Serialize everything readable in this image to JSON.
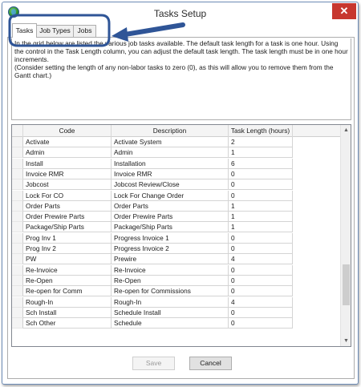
{
  "window": {
    "title": "Tasks Setup",
    "close_glyph": "✕",
    "icon": "app-globe-icon"
  },
  "tabs": [
    {
      "label": "Tasks",
      "active": true
    },
    {
      "label": "Job Types",
      "active": false
    },
    {
      "label": "Jobs",
      "active": false
    }
  ],
  "instructions": {
    "line1": "In the grid below are listed the various job tasks available.  The default task length for a task is one hour.  Using the control in the Task Length column, you can adjust the default task length.  The task length must be in one hour increments.",
    "line2": "(Consider setting the length of any non-labor tasks to zero (0), as this will allow you to remove them from the Gantt chart.)"
  },
  "grid": {
    "columns": [
      "Code",
      "Description",
      "Task Length (hours)"
    ],
    "rows": [
      {
        "code": "Activate",
        "description": "Activate System",
        "length": "2"
      },
      {
        "code": "Admin",
        "description": "Admin",
        "length": "1"
      },
      {
        "code": "Install",
        "description": "Installation",
        "length": "6"
      },
      {
        "code": "Invoice RMR",
        "description": "Invoice RMR",
        "length": "0"
      },
      {
        "code": "Jobcost",
        "description": "Jobcost Review/Close",
        "length": "0"
      },
      {
        "code": "Lock For CO",
        "description": "Lock For Change Order",
        "length": "0"
      },
      {
        "code": "Order Parts",
        "description": "Order Parts",
        "length": "1"
      },
      {
        "code": "Order Prewire Parts",
        "description": "Order Prewire Parts",
        "length": "1"
      },
      {
        "code": "Package/Ship Parts",
        "description": "Package/Ship Parts",
        "length": "1"
      },
      {
        "code": "Prog Inv 1",
        "description": "Progress Invoice 1",
        "length": "0"
      },
      {
        "code": "Prog Inv 2",
        "description": "Progress Invoice 2",
        "length": "0"
      },
      {
        "code": "PW",
        "description": "Prewire",
        "length": "4"
      },
      {
        "code": "Re-Invoice",
        "description": "Re-Invoice",
        "length": "0"
      },
      {
        "code": "Re-Open",
        "description": "Re-Open",
        "length": "0"
      },
      {
        "code": "Re-open for Comm",
        "description": "Re-open for Commissions",
        "length": "0"
      },
      {
        "code": "Rough-In",
        "description": "Rough-In",
        "length": "4"
      },
      {
        "code": "Sch Install",
        "description": "Schedule Install",
        "length": "0"
      },
      {
        "code": "Sch Other",
        "description": "Schedule",
        "length": "0"
      }
    ]
  },
  "scroll": {
    "up_glyph": "▲",
    "down_glyph": "▼"
  },
  "buttons": {
    "save": {
      "label": "Save",
      "enabled": false
    },
    "cancel": {
      "label": "Cancel",
      "enabled": true
    }
  },
  "colors": {
    "callout": "#2f5597",
    "close": "#c7372f"
  }
}
